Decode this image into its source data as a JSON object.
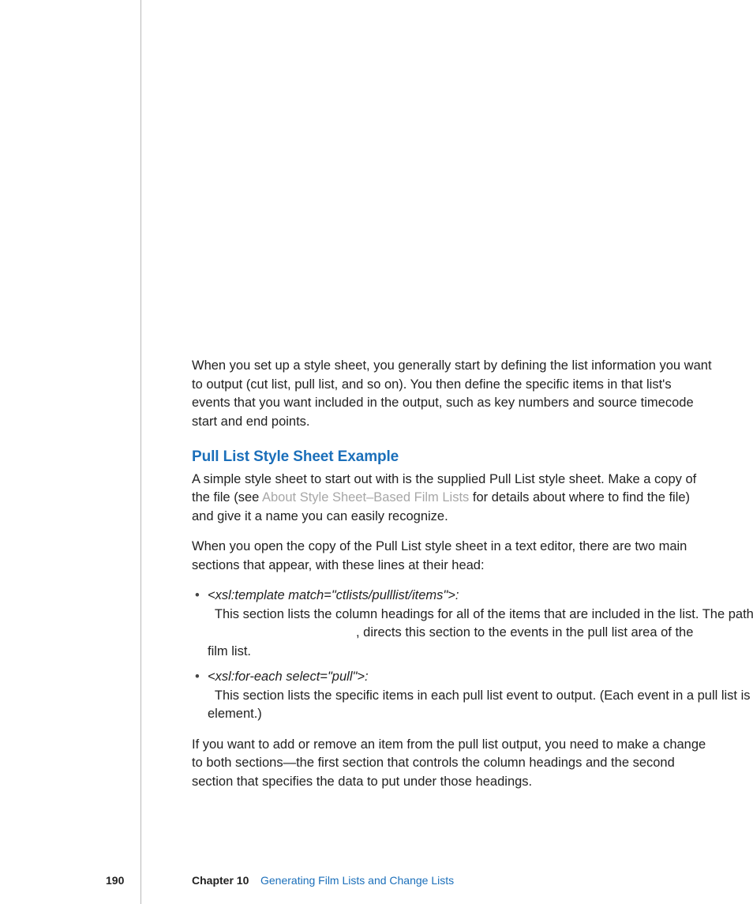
{
  "intro_para": "When you set up a style sheet, you generally start by defining the list information you want to output (cut list, pull list, and so on). You then define the specific items in that list's events that you want included in the output, such as key numbers and source timecode start and end points.",
  "section_heading": "Pull List Style Sheet Example",
  "para2_a": "A simple style sheet to start out with is the supplied Pull List style sheet. Make a copy of the file (see ",
  "para2_link": "About Style Sheet–Based Film Lists",
  "para2_b": " for details about where to find the file) and give it a name you can easily recognize.",
  "para3": "When you open the copy of the Pull List style sheet in a text editor, there are two main sections that appear, with these lines at their head:",
  "bullet1_term": "<xsl:template match=\"ctlists/pulllist/items\">:",
  "bullet1_text_a": "  This section lists the column headings for all of the items that are included in the list. The path that is listed, ",
  "bullet1_text_b": ", directs this section to the events in the pull list area of the film list.",
  "bullet2_term": "<xsl:for-each select=\"pull\">:",
  "bullet2_text_a": "  This section lists the specific items in each pull list event to output. (Each event in a pull list is wrapped by a ",
  "bullet2_text_b": " element.)",
  "closing_para": "If you want to add or remove an item from the pull list output, you need to make a change to both sections—the first section that controls the column headings and the second section that specifies the data to put under those headings.",
  "footer": {
    "page_number": "190",
    "chapter_label": "Chapter 10",
    "chapter_title": "Generating Film Lists and Change Lists"
  }
}
